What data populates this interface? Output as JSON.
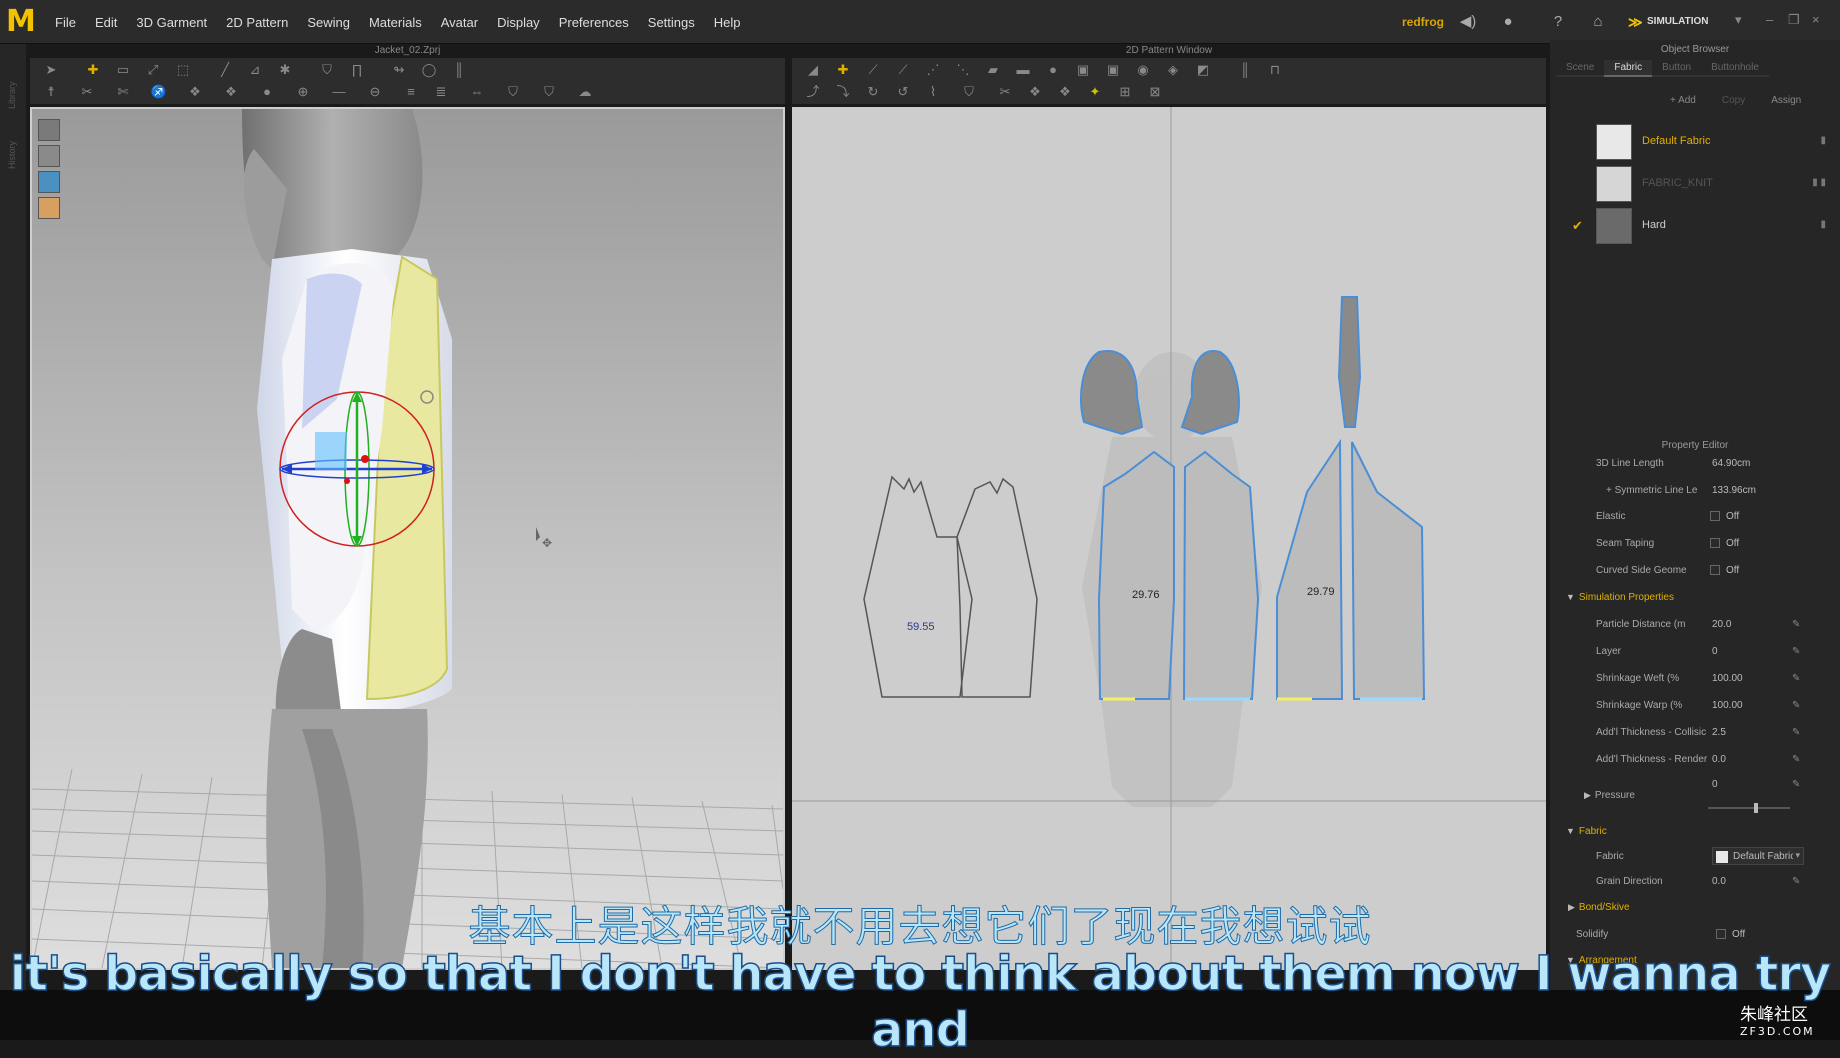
{
  "menu": [
    "File",
    "Edit",
    "3D Garment",
    "2D Pattern",
    "Sewing",
    "Materials",
    "Avatar",
    "Display",
    "Preferences",
    "Settings",
    "Help"
  ],
  "user": "redfrog",
  "mode": "SIMULATION",
  "left_strip": [
    "Library",
    "History"
  ],
  "viewport3d": {
    "title": "Jacket_02.Zprj"
  },
  "viewport2d": {
    "title": "2D Pattern Window",
    "measure_1": "59.55",
    "measure_2": "29.76",
    "measure_3": "29.79"
  },
  "object_browser": {
    "title": "Object Browser",
    "tabs": [
      "Scene",
      "Fabric",
      "Button",
      "Buttonhole"
    ],
    "actions": {
      "add": "+ Add",
      "copy": "Copy",
      "assign": "Assign"
    },
    "fabrics": [
      {
        "name": "Default Fabric",
        "color": "#e8e8e8",
        "text_color": "#e0b000"
      },
      {
        "name": "FABRIC_KNIT",
        "color": "#d6d6d6",
        "text_color": "#555555"
      },
      {
        "name": "Hard",
        "color": "#6a6a6a",
        "text_color": "#cccccc"
      }
    ]
  },
  "property_editor": {
    "title": "Property Editor",
    "line_length_label": "3D Line Length",
    "line_length_value": "64.90cm",
    "sym_label": "+ Symmetric Line Le",
    "sym_value": "133.96cm",
    "elastic_label": "Elastic",
    "elastic_value": "Off",
    "seam_label": "Seam Taping",
    "seam_value": "Off",
    "curved_label": "Curved Side Geome",
    "curved_value": "Off",
    "sim_section": "Simulation Properties",
    "particle_label": "Particle Distance (m",
    "particle_value": "20.0",
    "layer_label": "Layer",
    "layer_value": "0",
    "weft_label": "Shrinkage Weft (%",
    "weft_value": "100.00",
    "warp_label": "Shrinkage Warp (%",
    "warp_value": "100.00",
    "collision_label": "Add'l Thickness - Collisic",
    "collision_value": "2.5",
    "render_label": "Add'l Thickness - Render",
    "render_value": "0.0",
    "pressure_label": "Pressure",
    "pressure_value": "0",
    "fabric_section": "Fabric",
    "fabric_label": "Fabric",
    "fabric_value": "Default Fabric",
    "grain_label": "Grain Direction",
    "grain_value": "0.0",
    "bond_section": "Bond/Skive",
    "solidify_label": "Solidify",
    "solidify_value": "Off",
    "arrangement_section": "Arrangement"
  },
  "subtitle_cn": "基本上是这样我就不用去想它们了现在我想试试",
  "subtitle_en": "it's basically so that I don't have to think about them now I wanna try and",
  "watermark_cn": "朱峰社区",
  "watermark_en": "ZF3D.COM"
}
